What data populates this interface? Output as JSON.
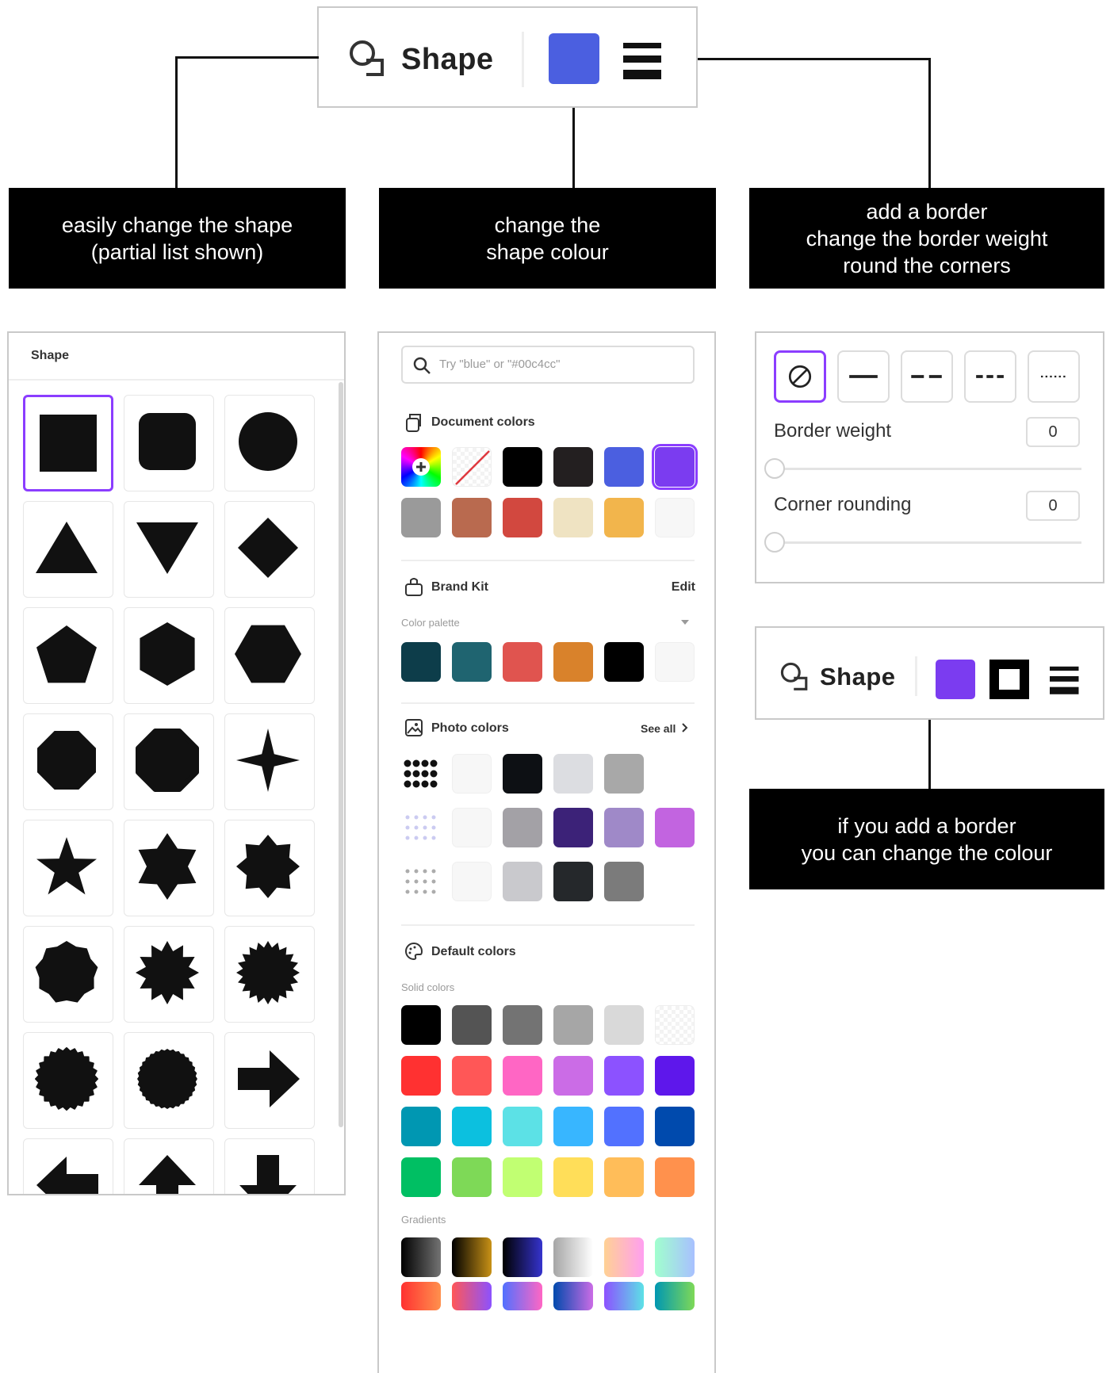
{
  "toolbar_top": {
    "label": "Shape",
    "color": "#4b5fe0"
  },
  "toolbar_second": {
    "label": "Shape",
    "color": "#7b3cf0"
  },
  "callouts": {
    "shapes": "easily change the shape\n(partial list shown)",
    "colour": "change the\nshape colour",
    "border": "add a border\nchange the border weight\nround the corners",
    "border_colour": "if you add a border\nyou can change the colour"
  },
  "shape_panel": {
    "title": "Shape",
    "shapes": [
      "square",
      "rounded-square",
      "circle",
      "triangle",
      "inverted-triangle",
      "diamond",
      "pentagon",
      "hexagon",
      "flat-hexagon",
      "octagon",
      "rounded-octagon",
      "four-point-star",
      "five-point-star",
      "six-point-star",
      "eight-point-star",
      "nonagon",
      "twelve-point-starburst",
      "twenty-point-starburst",
      "scalloped-circle",
      "scalloped-circle-fine",
      "arrow-right",
      "arrow-left",
      "arrow-up",
      "arrow-down"
    ]
  },
  "color_panel": {
    "search_placeholder": "Try \"blue\" or \"#00c4cc\"",
    "document_colors_title": "Document colors",
    "document_colors": [
      "#000000",
      "#231f20",
      "#4b5fe0",
      "#7b3cf0",
      "#9a9a9a",
      "#b96a4f",
      "#d2483f",
      "#efe3c2",
      "#f2b54c"
    ],
    "brand_kit_title": "Brand Kit",
    "brand_edit": "Edit",
    "palette_label": "Color palette",
    "brand_colors": [
      "#0d3d4a",
      "#1f6470",
      "#e0544f",
      "#d9822b",
      "#000000"
    ],
    "photo_colors_title": "Photo colors",
    "see_all": "See all",
    "photo_rows": [
      [
        "#f7f7f7",
        "#0d1014",
        "#dcdde1",
        "#a8a8a8"
      ],
      [
        "#f7f7f7",
        "#a3a1a6",
        "#3c2278",
        "#9f89c8",
        "#c264e0"
      ],
      [
        "#f7f7f7",
        "#c9c9cd",
        "#25282b",
        "#7b7b7b"
      ]
    ],
    "default_colors_title": "Default colors",
    "solid_label": "Solid colors",
    "solid_rows": [
      [
        "#000000",
        "#545454",
        "#737373",
        "#a6a6a6",
        "#d9d9d9"
      ],
      [
        "#ff3131",
        "#ff5757",
        "#ff66c4",
        "#cb6ce6",
        "#8c52ff",
        "#5e17eb"
      ],
      [
        "#0097b2",
        "#0cc0df",
        "#5ce1e6",
        "#38b6ff",
        "#5271ff",
        "#004aad"
      ],
      [
        "#00bf63",
        "#7ed957",
        "#c1ff72",
        "#ffde59",
        "#ffbd59",
        "#ff914d"
      ]
    ],
    "gradients_label": "Gradients",
    "gradient_rows": [
      [
        [
          "#000000",
          "#737373"
        ],
        [
          "#000000",
          "#c89116"
        ],
        [
          "#000000",
          "#3533cd"
        ],
        [
          "#a6a6a6",
          "#ffffff"
        ],
        [
          "#ffd194",
          "#ff9ff0"
        ],
        [
          "#a1ffce",
          "#a8c0ff"
        ]
      ],
      [
        [
          "#ff3131",
          "#ff914d"
        ],
        [
          "#ff5757",
          "#8c52ff"
        ],
        [
          "#5170ff",
          "#ff66c4"
        ],
        [
          "#004aad",
          "#cb6ce6"
        ],
        [
          "#8c52ff",
          "#5ce1e6"
        ],
        [
          "#0097b2",
          "#7ed957"
        ]
      ]
    ]
  },
  "border_panel": {
    "styles": [
      "none",
      "solid",
      "dashed-long",
      "dashed-short",
      "dotted"
    ],
    "border_weight_label": "Border weight",
    "border_weight_value": "0",
    "corner_rounding_label": "Corner rounding",
    "corner_rounding_value": "0"
  }
}
